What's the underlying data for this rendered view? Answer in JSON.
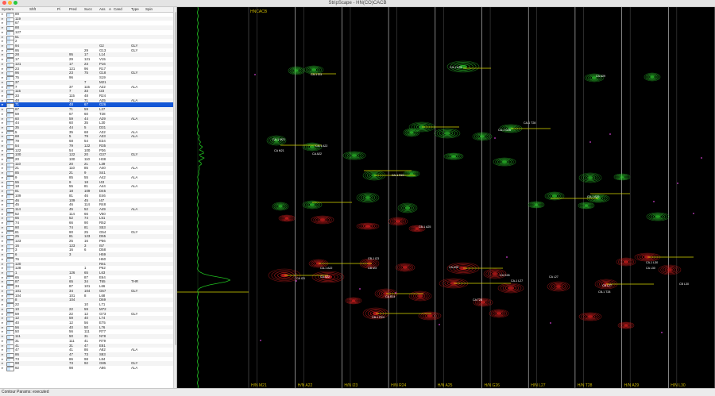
{
  "window": {
    "title": "StripScape - HN(CO)CACB"
  },
  "table": {
    "columns": {
      "system": "System",
      "shift": "Shft",
      "pi": "Pi",
      "pred": "Pred",
      "succ": "Succ",
      "ass": "Ass",
      "a": "A",
      "cand": "Cand",
      "type": "Type",
      "spin": "Spin"
    },
    "rows": [
      [
        "89",
        "",
        "",
        "",
        ""
      ],
      [
        "119",
        "",
        "",
        "",
        ""
      ],
      [
        "67",
        "",
        "",
        "",
        ""
      ],
      [
        "88",
        "",
        "",
        "",
        ""
      ],
      [
        "127",
        "",
        "",
        "",
        ""
      ],
      [
        "51",
        "",
        "",
        "",
        ""
      ],
      [
        "2",
        "",
        "",
        "",
        ""
      ],
      [
        "94",
        "",
        "",
        "G2",
        "GLY"
      ],
      [
        "95",
        "",
        "29",
        "G13",
        "GLY"
      ],
      [
        "28",
        "95",
        "17",
        "L14",
        ""
      ],
      [
        "17",
        "29",
        "121",
        "V15",
        ""
      ],
      [
        "121",
        "17",
        "23",
        "P16",
        ""
      ],
      [
        "23",
        "121",
        "96",
        "R17",
        ""
      ],
      [
        "96",
        "23",
        "75",
        "G18",
        "GLY"
      ],
      [
        "75",
        "96",
        "",
        "S19",
        ""
      ],
      [
        "37",
        "",
        "7",
        "M21",
        ""
      ],
      [
        "7",
        "37",
        "115",
        "A22",
        "ALA"
      ],
      [
        "115",
        "7",
        "33",
        "I23",
        ""
      ],
      [
        "33",
        "115",
        "48",
        "R24",
        ""
      ],
      [
        "48",
        "33",
        "71",
        "A25",
        "ALA"
      ],
      [
        "71",
        "48",
        "67",
        "G26",
        ""
      ],
      [
        "67",
        "71",
        "59",
        "L27",
        ""
      ],
      [
        "59",
        "67",
        "60",
        "T28",
        ""
      ],
      [
        "60",
        "59",
        "44",
        "A29",
        "ALA"
      ],
      [
        "44",
        "60",
        "35",
        "L30",
        ""
      ],
      [
        "35",
        "44",
        "5",
        "D31",
        ""
      ],
      [
        "5",
        "35",
        "68",
        "A32",
        "ALA"
      ],
      [
        "68",
        "5",
        "79",
        "A33",
        "ALA"
      ],
      [
        "79",
        "68",
        "54",
        "E34",
        ""
      ],
      [
        "54",
        "79",
        "122",
        "R35",
        ""
      ],
      [
        "122",
        "54",
        "100",
        "P36",
        ""
      ],
      [
        "100",
        "122",
        "20",
        "G37",
        "GLY"
      ],
      [
        "20",
        "100",
        "110",
        "H38",
        ""
      ],
      [
        "110",
        "20",
        "21",
        "L39",
        ""
      ],
      [
        "21",
        "110",
        "85",
        "A40",
        "ALA"
      ],
      [
        "85",
        "21",
        "9",
        "S41",
        ""
      ],
      [
        "9",
        "85",
        "55",
        "A42",
        "ALA"
      ],
      [
        "55",
        "9",
        "18",
        "I43",
        ""
      ],
      [
        "18",
        "55",
        "81",
        "A44",
        "ALA"
      ],
      [
        "81",
        "18",
        "109",
        "D45",
        ""
      ],
      [
        "109",
        "81",
        "46",
        "E46",
        ""
      ],
      [
        "46",
        "109",
        "45",
        "I47",
        ""
      ],
      [
        "45",
        "46",
        "114",
        "R48",
        ""
      ],
      [
        "114",
        "45",
        "52",
        "A49",
        "ALA"
      ],
      [
        "52",
        "114",
        "66",
        "V50",
        ""
      ],
      [
        "66",
        "52",
        "74",
        "L51",
        ""
      ],
      [
        "74",
        "66",
        "90",
        "R52",
        ""
      ],
      [
        "90",
        "74",
        "81",
        "S53",
        ""
      ],
      [
        "81",
        "90",
        "25",
        "G54",
        "GLY"
      ],
      [
        "25",
        "81",
        "123",
        "D55",
        ""
      ],
      [
        "123",
        "25",
        "16",
        "P56",
        ""
      ],
      [
        "16",
        "123",
        "3",
        "I57",
        ""
      ],
      [
        "3",
        "16",
        "6",
        "D58",
        ""
      ],
      [
        "6",
        "3",
        "",
        "H59",
        ""
      ],
      [
        "76",
        "",
        "",
        "H60",
        ""
      ],
      [
        "120",
        "",
        "",
        "R61",
        ""
      ],
      [
        "128",
        "",
        "1",
        "P62",
        ""
      ],
      [
        "1",
        "126",
        "65",
        "L63",
        ""
      ],
      [
        "65",
        "1",
        "87",
        "E64",
        ""
      ],
      [
        "87",
        "65",
        "34",
        "T65",
        "THR"
      ],
      [
        "34",
        "87",
        "101",
        "L66",
        ""
      ],
      [
        "101",
        "34",
        "104",
        "G67",
        "GLY"
      ],
      [
        "104",
        "101",
        "8",
        "L68",
        ""
      ],
      [
        "8",
        "104",
        "",
        "D69",
        ""
      ],
      [
        "22",
        "",
        "10",
        "L71",
        ""
      ],
      [
        "10",
        "22",
        "59",
        "M72",
        ""
      ],
      [
        "59",
        "22",
        "12",
        "G73",
        "GLY"
      ],
      [
        "12",
        "59",
        "40",
        "L74",
        ""
      ],
      [
        "40",
        "12",
        "56",
        "E75",
        ""
      ],
      [
        "56",
        "40",
        "50",
        "L76",
        ""
      ],
      [
        "50",
        "56",
        "111",
        "R77",
        ""
      ],
      [
        "111",
        "50",
        "31",
        "N78",
        ""
      ],
      [
        "31",
        "111",
        "41",
        "R79",
        ""
      ],
      [
        "41",
        "31",
        "47",
        "E81",
        ""
      ],
      [
        "47",
        "41",
        "86",
        "A82",
        "ALA"
      ],
      [
        "86",
        "47",
        "73",
        "S83",
        ""
      ],
      [
        "73",
        "86",
        "98",
        "L84",
        ""
      ],
      [
        "98",
        "73",
        "92",
        "G85",
        "GLY"
      ],
      [
        "92",
        "98",
        "",
        "A86",
        "ALA"
      ]
    ],
    "selected_index": 20
  },
  "spectrum": {
    "title": "HNCACB",
    "strips": [
      "H/N M21",
      "H/N A22",
      "H/N I23",
      "H/N R24",
      "H/N A25",
      "H/N G26",
      "H/N L27",
      "H/N T28",
      "H/N A29",
      "H/N L30"
    ],
    "peak_labels": [
      [
        "CA-1 M21",
        "CA M21",
        "CA-1 A22",
        "CA A22",
        "CA-1 A22",
        "CA A22"
      ],
      [
        "CA-1 I23",
        "CA I23",
        "CB-1 I23",
        "CB I23"
      ],
      [
        "CA-1 R24",
        "CB-1 R24",
        "CA R24"
      ],
      [
        "CA-1 A25",
        "CA A25",
        "CB-1 A25"
      ],
      [
        "CA-1 G26",
        "CA G26",
        "CA-1 L27",
        "CA L27",
        "CB L27"
      ],
      [
        "CA-1 T28",
        "CA T28",
        "CB-1 T28"
      ],
      [
        "CA-1 A29",
        "CA A29",
        "CA-1 L30",
        "CA L30",
        "CB L30"
      ]
    ]
  },
  "status": {
    "text": "Contour Params: executed"
  },
  "colors": {
    "positive_peak": "#2ecc2e",
    "negative_peak": "#e02020",
    "link_line": "#d8d800",
    "selection": "#1457d6",
    "strip_line": "#d8d8d8"
  }
}
